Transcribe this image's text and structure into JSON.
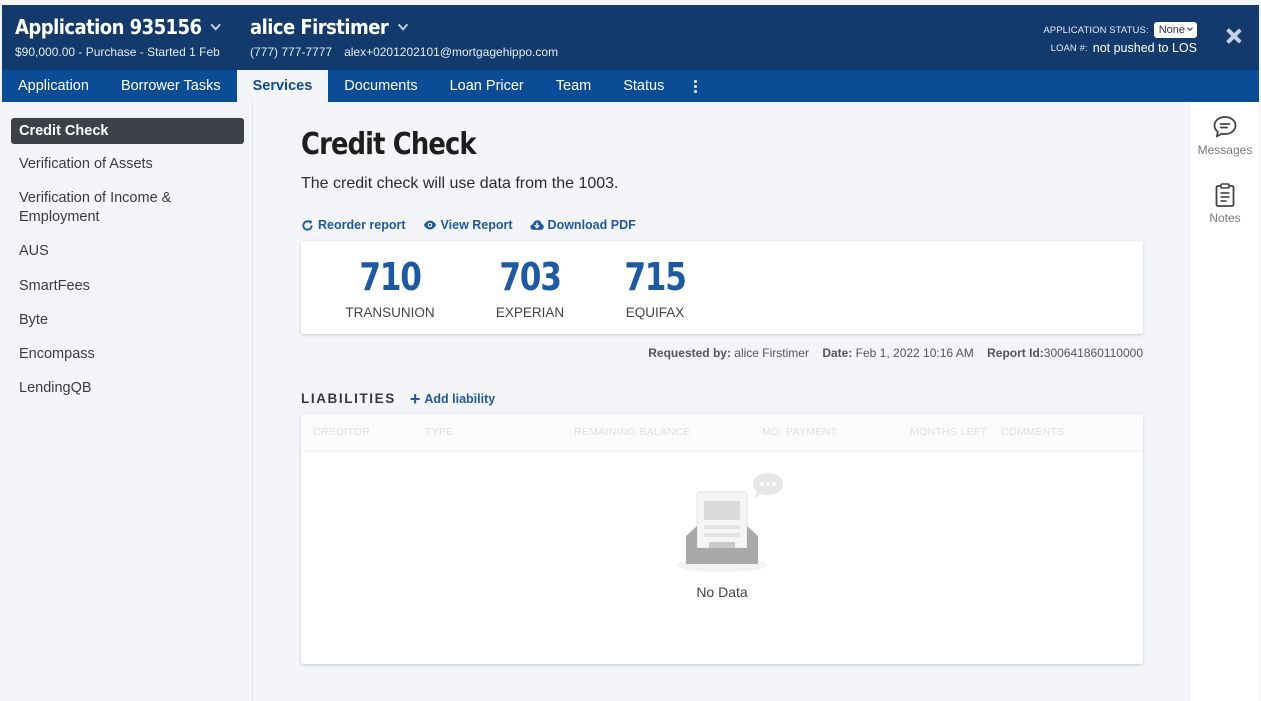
{
  "header": {
    "app_title": "Application 935156",
    "app_sub": "$90,000.00 - Purchase - Started 1 Feb",
    "borrower_name": "alice Firstimer",
    "phone": "(777) 777-7777",
    "email": "alex+0201202101@mortgagehippo.com",
    "status_label": "APPLICATION STATUS:",
    "status_value": "None",
    "loan_label": "LOAN #:",
    "loan_value": "not pushed to LOS"
  },
  "tabs": [
    {
      "label": "Application"
    },
    {
      "label": "Borrower Tasks"
    },
    {
      "label": "Services",
      "active": true
    },
    {
      "label": "Documents"
    },
    {
      "label": "Loan Pricer"
    },
    {
      "label": "Team"
    },
    {
      "label": "Status"
    }
  ],
  "sidebar": {
    "items": [
      {
        "label": "Credit Check",
        "active": true
      },
      {
        "label": "Verification of Assets"
      },
      {
        "label": "Verification of Income & Employment"
      },
      {
        "label": "AUS"
      },
      {
        "label": "SmartFees"
      },
      {
        "label": "Byte"
      },
      {
        "label": "Encompass"
      },
      {
        "label": "LendingQB"
      }
    ]
  },
  "rail": {
    "messages_label": "Messages",
    "notes_label": "Notes"
  },
  "main": {
    "title": "Credit Check",
    "description": "The credit check will use data from the 1003.",
    "actions": {
      "reorder": "Reorder report",
      "view": "View Report",
      "download": "Download PDF"
    },
    "scores": [
      {
        "value": "710",
        "bureau": "TRANSUNION"
      },
      {
        "value": "703",
        "bureau": "EXPERIAN"
      },
      {
        "value": "715",
        "bureau": "EQUIFAX"
      }
    ],
    "meta": {
      "requested_by_label": "Requested by:",
      "requested_by": "alice Firstimer",
      "date_label": "Date:",
      "date": "Feb 1, 2022 10:16 AM",
      "report_id_label": "Report Id:",
      "report_id": "300641860110000"
    },
    "liabilities": {
      "title": "LIABILITIES",
      "add_label": "Add liability",
      "columns": [
        "CREDITOR",
        "TYPE",
        "REMAINING BALANCE",
        "MO. PAYMENT",
        "MONTHS LEFT",
        "COMMENTS"
      ],
      "empty_text": "No Data"
    }
  },
  "colors": {
    "header_bg": "#123a6c",
    "tabs_bg": "#0b4c96",
    "accent": "#1c5aa7",
    "sidebar_active": "#3e4248"
  }
}
